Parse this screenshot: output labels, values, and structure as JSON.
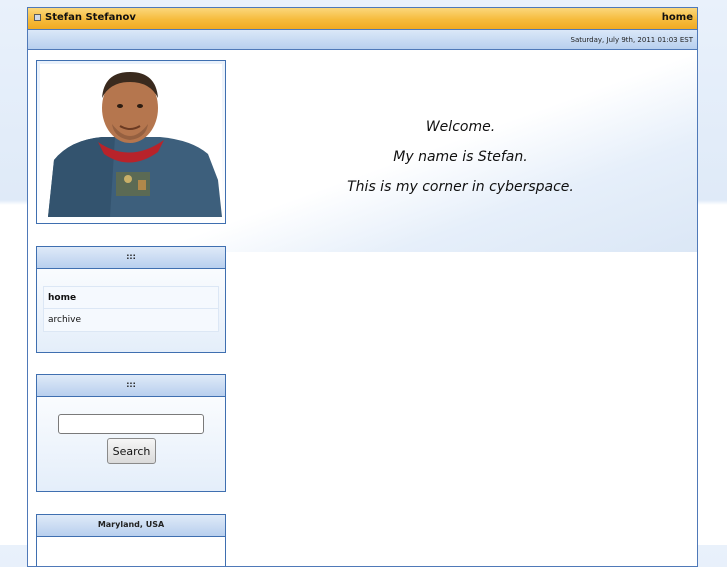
{
  "header": {
    "site_name": "Stefan Stefanov",
    "home_link": "home",
    "date": "Saturday, July 9th, 2011 01:03 EST"
  },
  "nav_box": {
    "title": ":::",
    "items": [
      {
        "label": "home"
      },
      {
        "label": "archive"
      }
    ]
  },
  "search_box": {
    "title": ":::",
    "input_value": "",
    "button_label": "Search"
  },
  "location_box": {
    "title": "Maryland, USA"
  },
  "welcome": {
    "lines": [
      "Welcome.",
      "My name is Stefan.",
      "This is my corner in cyberspace."
    ]
  },
  "icons": [
    "bullet-square-icon"
  ],
  "colors": {
    "accent": "#f6bb3c",
    "border": "#4f79b8"
  }
}
